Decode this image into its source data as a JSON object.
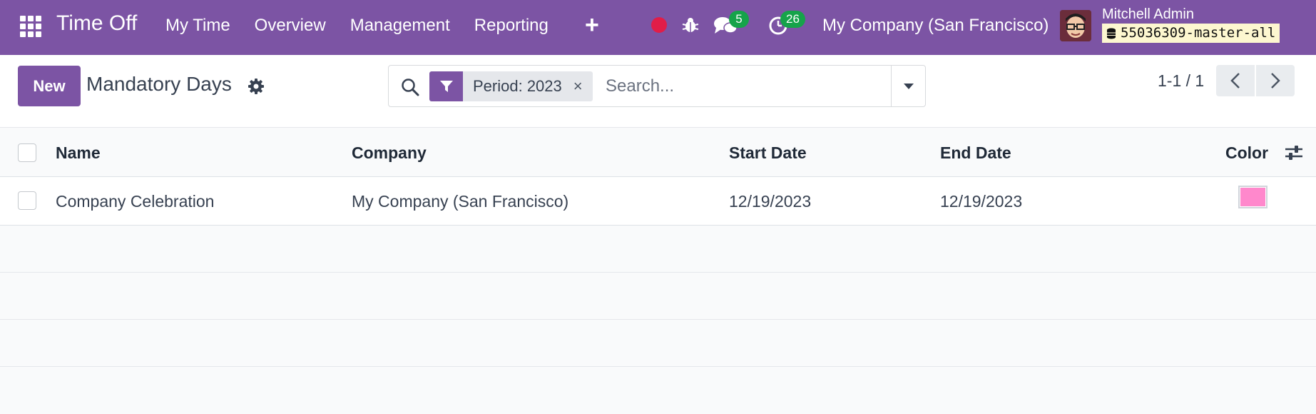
{
  "navbar": {
    "app_title": "Time Off",
    "menu": [
      "My Time",
      "Overview",
      "Management",
      "Reporting"
    ],
    "plus_label": "+",
    "messages_count": "5",
    "activities_count": "26",
    "company": "My Company (San Francisco)",
    "user_name": "Mitchell Admin",
    "database": "55036309-master-all",
    "record_color": "#e11d48"
  },
  "control_panel": {
    "new_label": "New",
    "title": "Mandatory Days",
    "search": {
      "facet_label": "Period: 2023",
      "facet_remove": "×",
      "placeholder": "Search..."
    },
    "pager": "1-1 / 1"
  },
  "table": {
    "columns": [
      "Name",
      "Company",
      "Start Date",
      "End Date",
      "Color"
    ],
    "rows": [
      {
        "name": "Company Celebration",
        "company": "My Company (San Francisco)",
        "start_date": "12/19/2023",
        "end_date": "12/19/2023",
        "color": "#ff88cc"
      }
    ]
  },
  "colors": {
    "brand": "#7c54a4",
    "badge": "#16a34a"
  },
  "icons": [
    "apps-icon",
    "bug-icon",
    "chat-icon",
    "activity-clock-icon",
    "database-icon",
    "gear-icon",
    "search-icon",
    "filter-icon",
    "caret-down-icon",
    "chevron-left-icon",
    "chevron-right-icon",
    "column-settings-icon"
  ]
}
